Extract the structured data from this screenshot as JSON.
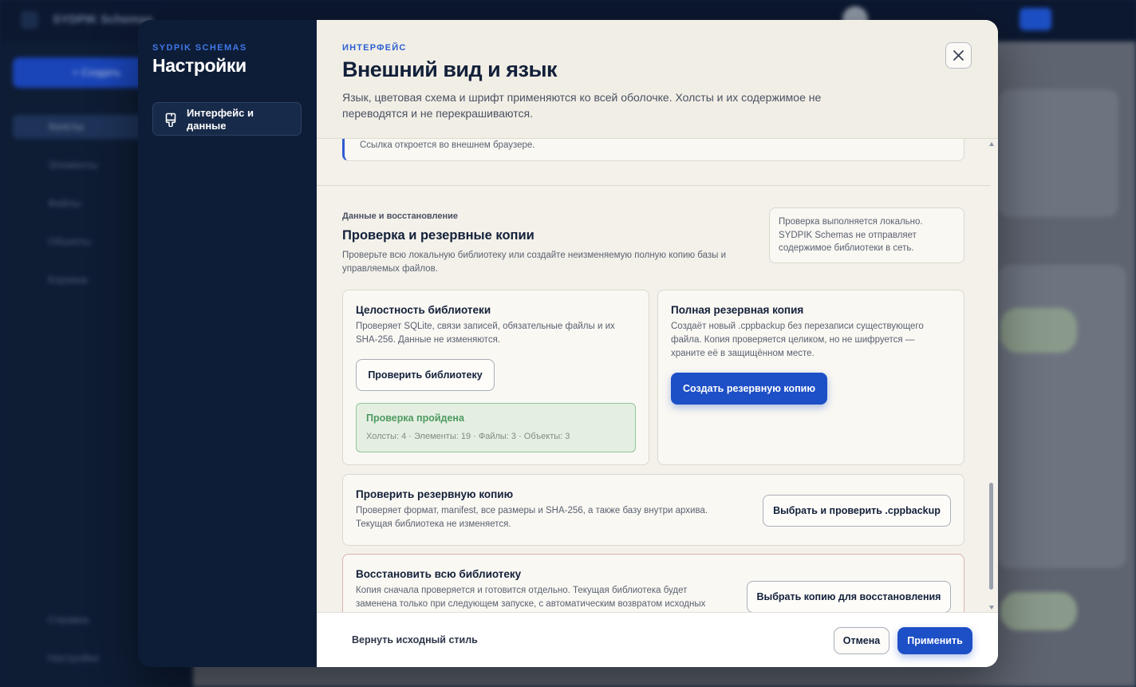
{
  "background": {
    "app_title": "SYDPIK Schemas",
    "new_button": "+ Создать",
    "nav_items": [
      "Холсты",
      "Элементы",
      "Файлы",
      "Объекты",
      "Корзина"
    ],
    "bottom_items": [
      "Справка",
      "Настройки"
    ],
    "topbar_button_icon": "plus-icon"
  },
  "sidebar": {
    "brand": "SYDPIK SCHEMAS",
    "title": "Настройки",
    "items": [
      {
        "label": "Интерфейс и данные",
        "icon": "paintbrush-icon",
        "active": true
      }
    ]
  },
  "header": {
    "kicker": "ИНТЕРФЕЙС",
    "title": "Внешний вид и язык",
    "description": "Язык, цветовая схема и шрифт применяются ко всей оболочке. Холсты и их содержимое не переводятся и не перекрашиваются.",
    "close_icon": "close-icon"
  },
  "link_note": "Ссылка откроется во внешнем браузере.",
  "data_section": {
    "kicker": "Данные и восстановление",
    "title": "Проверка и резервные копии",
    "description": "Проверьте всю локальную библиотеку или создайте неизменяемую полную копию базы и управляемых файлов.",
    "privacy_note": "Проверка выполняется локально. SYDPIK Schemas не отправляет содержимое библиотеки в сеть.",
    "integrity": {
      "title": "Целостность библиотеки",
      "description": "Проверяет SQLite, связи записей, обязательные файлы и их SHA-256. Данные не изменяются.",
      "button": "Проверить библиотеку",
      "result_title": "Проверка пройдена",
      "result_stats": "Холсты: 4 · Элементы: 19 · Файлы: 3 · Объекты: 3"
    },
    "full_backup": {
      "title": "Полная резервная копия",
      "description": "Создаёт новый .cppbackup без перезаписи существующего файла. Копия проверяется целиком, но не шифруется — храните её в защищённом месте.",
      "button": "Создать резервную копию"
    },
    "verify_backup": {
      "title": "Проверить резервную копию",
      "description": "Проверяет формат, manifest, все размеры и SHA-256, а также базу внутри архива. Текущая библиотека не изменяется.",
      "button": "Выбрать и проверить .cppbackup"
    },
    "restore": {
      "title": "Восстановить всю библиотеку",
      "description": "Копия сначала проверяется и готовится отдельно. Текущая библиотека будет заменена только при следующем запуске, с автоматическим возвратом исходных",
      "button": "Выбрать копию для восстановления"
    }
  },
  "footer": {
    "reset": "Вернуть исходный стиль",
    "cancel": "Отмена",
    "apply": "Применить"
  },
  "colors": {
    "accent": "#1d4fc6",
    "sidebar_bg": "#0e1d37",
    "content_bg": "#f3f1ea",
    "success_bg": "#e4efe2",
    "success_text": "#4f9a61",
    "danger_border": "#d7b3ae"
  }
}
